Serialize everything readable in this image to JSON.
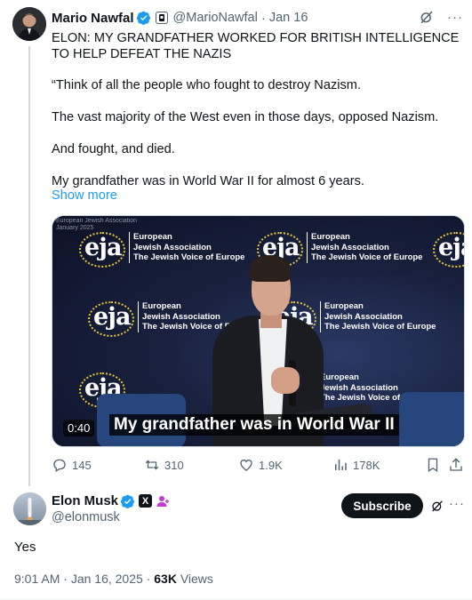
{
  "parent_tweet": {
    "author_name": "Mario Nawfal",
    "handle": "@MarioNawfal",
    "date": "Jan 16",
    "separator": "·",
    "text": [
      "ELON: MY GRANDFATHER WORKED FOR BRITISH INTELLIGENCE TO HELP DEFEAT THE NAZIS",
      "“Think of all the people who fought to destroy Nazism.",
      "The vast majority of the West even in those days, opposed Nazism.",
      "And fought, and died.",
      "My grandfather was in World War II for almost 6 years."
    ],
    "show_more": "Show more",
    "media": {
      "duration": "0:40",
      "caption": "My grandfather was in World War II",
      "event_title": "European Jewish Association\nJanuary 2025",
      "logo_mark": "eja",
      "logo_text": [
        "European",
        "Jewish Association",
        "The Jewish Voice of Europe"
      ]
    },
    "actions": {
      "replies": "145",
      "reposts": "310",
      "likes": "1.9K",
      "views": "178K"
    }
  },
  "reply_tweet": {
    "author_name": "Elon Musk",
    "handle": "@elonmusk",
    "x_badge": "X",
    "subscribe_label": "Subscribe",
    "more_label": "···",
    "text": "Yes",
    "time": "9:01 AM",
    "date": "Jan 16, 2025",
    "views_count": "63K",
    "views_label": "Views"
  },
  "colors": {
    "verified": "#1d9bf0",
    "link": "#1d9bf0",
    "secondary_text": "#536471",
    "subscribe_bg": "#0f1419"
  },
  "icons": [
    "verified-badge-icon",
    "affiliate-badge-icon",
    "grok-icon",
    "more-icon",
    "reply-icon",
    "repost-icon",
    "like-icon",
    "views-icon",
    "bookmark-icon",
    "share-icon",
    "x-badge-icon",
    "person-badge-icon"
  ]
}
